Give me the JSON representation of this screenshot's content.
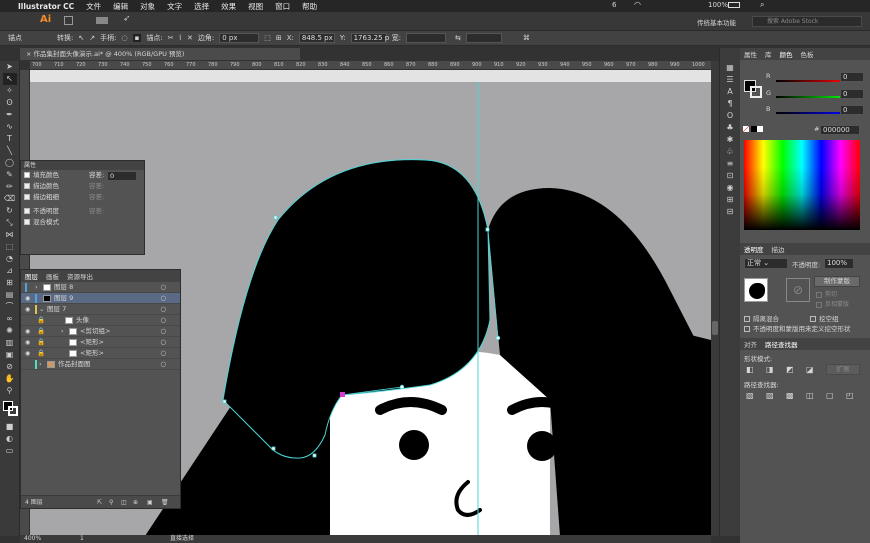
{
  "menubar": {
    "app": "Illustrator CC",
    "items": [
      "文件",
      "编辑",
      "对象",
      "文字",
      "选择",
      "效果",
      "视图",
      "窗口",
      "帮助"
    ],
    "battery": "100%",
    "notif_count": "6"
  },
  "appbar": {
    "workspace": "传统基本功能",
    "search_placeholder": "搜索 Adobe Stock"
  },
  "control": {
    "selection_label": "锚点",
    "convert_label": "转换:",
    "handle_label": "手柄:",
    "anchor_label": "锚点:",
    "corner_label": "边角:",
    "corner_value": "0 px",
    "x_label": "X:",
    "x_value": "848.5 px",
    "y_label": "Y:",
    "y_value": "1763.25 p",
    "w_label": "宽:"
  },
  "doc_tab": "作品集封面头像演示.ai* @ 400% (RGB/GPU 预览)",
  "ruler_ticks": [
    "700",
    "710",
    "720",
    "730",
    "740",
    "750",
    "760",
    "770",
    "780",
    "790",
    "800",
    "810",
    "820",
    "830",
    "840",
    "850",
    "860",
    "870",
    "880",
    "890",
    "900",
    "910",
    "920",
    "930",
    "940",
    "950",
    "960",
    "970",
    "980",
    "990",
    "1000"
  ],
  "status": {
    "zoom": "400%",
    "page": "1",
    "tool": "直接选择"
  },
  "appearance_panel": {
    "title": "属性",
    "fill_label": "填充颜色",
    "tolerance_label": "容差:",
    "tolerance_value": "0",
    "stroke_label": "描边颜色",
    "stroke_tolerance": "容差:",
    "weight_label": "描边粗细",
    "weight_tolerance": "容差:",
    "opacity_label": "不透明度",
    "opacity_tolerance": "容差:",
    "blend_label": "混合模式"
  },
  "layers_panel": {
    "tabs": [
      "图层",
      "画板",
      "资源导出"
    ],
    "rows": [
      {
        "name": "图层 8",
        "indent": 0,
        "selected": false,
        "color": "#4fa3e0"
      },
      {
        "name": "图层 9",
        "indent": 0,
        "selected": true,
        "color": "#4fa3e0"
      },
      {
        "name": "图层 7",
        "indent": 0,
        "selected": false,
        "color": "#e0c34f"
      },
      {
        "name": "头像",
        "indent": 1,
        "selected": false,
        "color": "#e0c34f"
      },
      {
        "name": "<剪切组>",
        "indent": 1,
        "selected": false,
        "color": "#e0c34f"
      },
      {
        "name": "<矩形>",
        "indent": 1,
        "selected": false,
        "color": "#e0c34f"
      },
      {
        "name": "<矩形>",
        "indent": 1,
        "selected": false,
        "color": "#e0c34f"
      },
      {
        "name": "作品封面图",
        "indent": 0,
        "selected": false,
        "color": "#4fe0c3"
      }
    ],
    "footer": "4 图层"
  },
  "color_panel": {
    "tabs": [
      "属性",
      "库",
      "颜色",
      "色板"
    ],
    "r_label": "R",
    "r_value": "0",
    "g_label": "G",
    "g_value": "0",
    "b_label": "B",
    "b_value": "0",
    "hex_value": "000000"
  },
  "transparency_panel": {
    "tabs": [
      "透明度",
      "描边"
    ],
    "mode": "正常",
    "opacity_label": "不透明度:",
    "opacity_value": "100%",
    "make_mask": "制作蒙版",
    "clip": "剪切",
    "invert": "反相蒙版",
    "isolate": "隔离混合",
    "knockout": "挖空组",
    "opacity_mask": "不透明度和蒙版用来定义挖空形状"
  },
  "pathfinder_panel": {
    "tabs": [
      "对齐",
      "路径查找器"
    ],
    "shape_modes": "形状模式:",
    "expand": "扩展",
    "pathfinders": "路径查找器:"
  },
  "colors": {
    "accent": "#4fd4d4",
    "fill": "#000000",
    "anchor": "#d23ad2"
  }
}
